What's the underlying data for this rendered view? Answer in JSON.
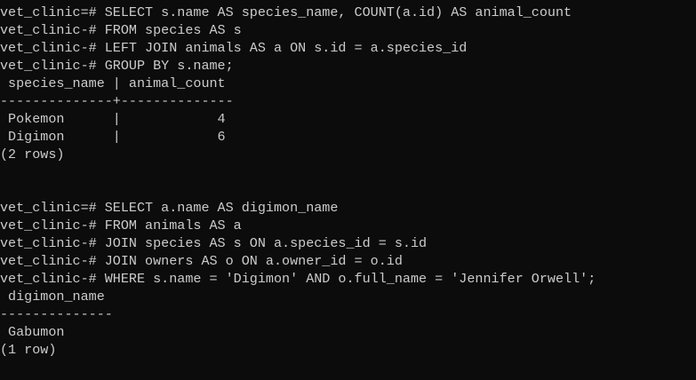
{
  "terminal": {
    "lines": [
      "vet_clinic=# SELECT s.name AS species_name, COUNT(a.id) AS animal_count",
      "vet_clinic-# FROM species AS s",
      "vet_clinic-# LEFT JOIN animals AS a ON s.id = a.species_id",
      "vet_clinic-# GROUP BY s.name;",
      " species_name | animal_count",
      "--------------+--------------",
      " Pokemon      |            4",
      " Digimon      |            6",
      "(2 rows)",
      "",
      "",
      "vet_clinic=# SELECT a.name AS digimon_name",
      "vet_clinic-# FROM animals AS a",
      "vet_clinic-# JOIN species AS s ON a.species_id = s.id",
      "vet_clinic-# JOIN owners AS o ON a.owner_id = o.id",
      "vet_clinic-# WHERE s.name = 'Digimon' AND o.full_name = 'Jennifer Orwell';",
      " digimon_name",
      "--------------",
      " Gabumon",
      "(1 row)"
    ]
  },
  "colors": {
    "background": "#0c0c0c",
    "foreground": "#cccccc"
  }
}
